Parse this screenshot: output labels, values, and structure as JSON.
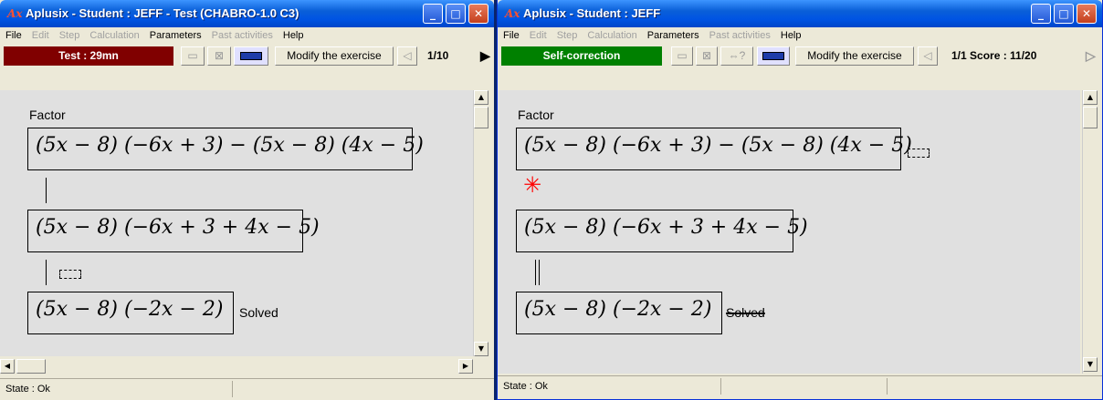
{
  "left": {
    "title": "Aplusix - Student : JEFF - Test (CHABRO-1.0 C3)",
    "menu": [
      "File",
      "Edit",
      "Step",
      "Calculation",
      "Parameters",
      "Past activities",
      "Help"
    ],
    "mode_label": "Test : 29mn",
    "modify_label": "Modify the exercise",
    "nav_label": "1/10",
    "task": "Factor",
    "steps": [
      "(5x − 8) (−6x + 3) − (5x − 8) (4x − 5)",
      "(5x − 8) (−6x + 3 + 4x − 5)",
      "(5x − 8) (−2x − 2)"
    ],
    "solved": "Solved",
    "status": "State : Ok"
  },
  "right": {
    "title": "Aplusix - Student : JEFF",
    "menu": [
      "File",
      "Edit",
      "Step",
      "Calculation",
      "Parameters",
      "Past activities",
      "Help"
    ],
    "mode_label": "Self-correction",
    "modify_label": "Modify the exercise",
    "nav_label": "1/1  Score : 11/20",
    "task": "Factor",
    "steps": [
      "(5x − 8) (−6x + 3) − (5x − 8) (4x − 5)",
      "(5x − 8) (−6x + 3 + 4x − 5)",
      "(5x − 8) (−2x − 2)"
    ],
    "solved": "Solved",
    "status": "State : Ok"
  },
  "colors": {
    "test_bar": "#800000",
    "selfcorr_bar": "#008000",
    "error_mark": "#ff0000",
    "title_blue": "#0054e3"
  },
  "icons": [
    "aplusix-logo-icon",
    "minimize-icon",
    "maximize-icon",
    "close-icon",
    "keyboard-icon",
    "triangle-left-icon",
    "triangle-right-icon",
    "error-star-icon"
  ]
}
